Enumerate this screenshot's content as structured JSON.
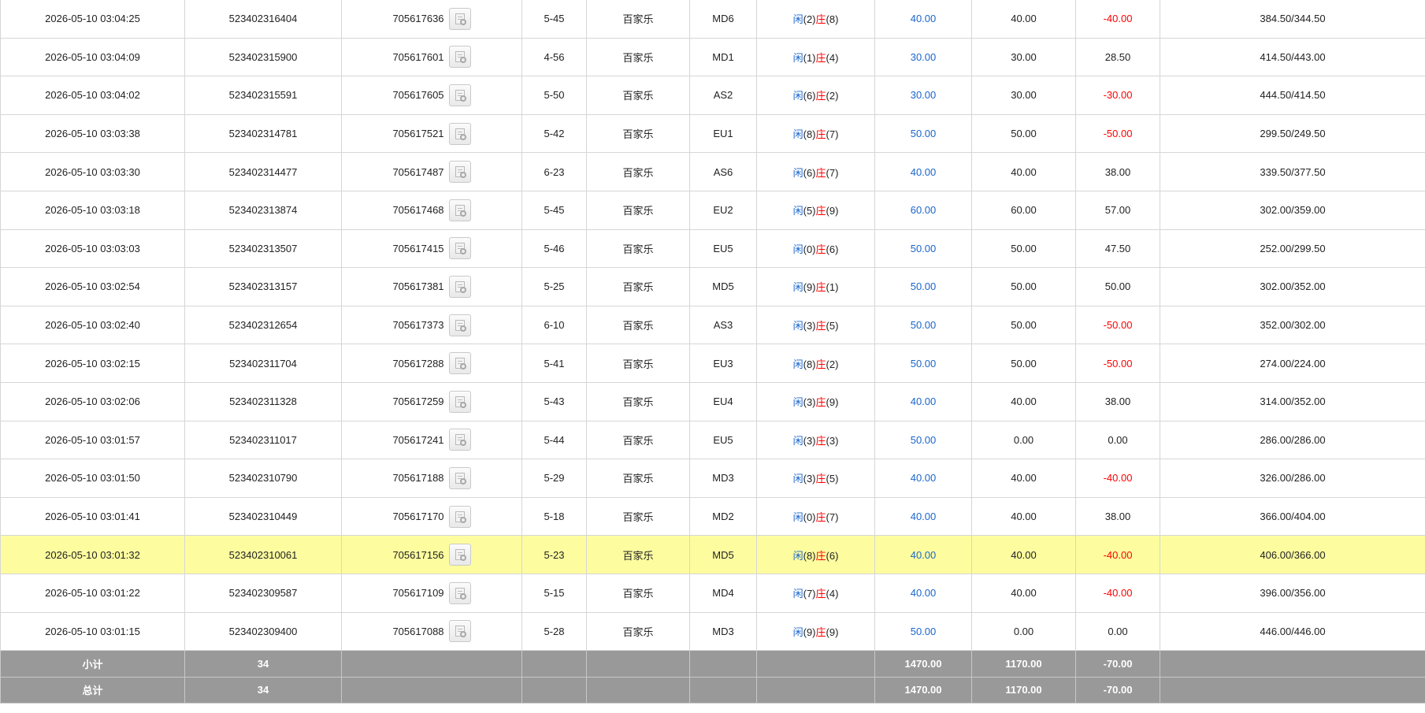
{
  "rows": [
    {
      "time": "2026-05-10 03:04:25",
      "bet_id": "523402316404",
      "round_id": "705617636",
      "shoe": "5-45",
      "game": "百家乐",
      "table": "MD6",
      "xian": "闲",
      "xian_pts": "(2)",
      "zhuang": "庄",
      "zhuang_pts": "(8)",
      "bet": "40.00",
      "valid": "40.00",
      "winloss": "-40.00",
      "balance": "384.50/344.50"
    },
    {
      "time": "2026-05-10 03:04:09",
      "bet_id": "523402315900",
      "round_id": "705617601",
      "shoe": "4-56",
      "game": "百家乐",
      "table": "MD1",
      "xian": "闲",
      "xian_pts": "(1)",
      "zhuang": "庄",
      "zhuang_pts": "(4)",
      "bet": "30.00",
      "valid": "30.00",
      "winloss": "28.50",
      "balance": "414.50/443.00"
    },
    {
      "time": "2026-05-10 03:04:02",
      "bet_id": "523402315591",
      "round_id": "705617605",
      "shoe": "5-50",
      "game": "百家乐",
      "table": "AS2",
      "xian": "闲",
      "xian_pts": "(6)",
      "zhuang": "庄",
      "zhuang_pts": "(2)",
      "bet": "30.00",
      "valid": "30.00",
      "winloss": "-30.00",
      "balance": "444.50/414.50"
    },
    {
      "time": "2026-05-10 03:03:38",
      "bet_id": "523402314781",
      "round_id": "705617521",
      "shoe": "5-42",
      "game": "百家乐",
      "table": "EU1",
      "xian": "闲",
      "xian_pts": "(8)",
      "zhuang": "庄",
      "zhuang_pts": "(7)",
      "bet": "50.00",
      "valid": "50.00",
      "winloss": "-50.00",
      "balance": "299.50/249.50"
    },
    {
      "time": "2026-05-10 03:03:30",
      "bet_id": "523402314477",
      "round_id": "705617487",
      "shoe": "6-23",
      "game": "百家乐",
      "table": "AS6",
      "xian": "闲",
      "xian_pts": "(6)",
      "zhuang": "庄",
      "zhuang_pts": "(7)",
      "bet": "40.00",
      "valid": "40.00",
      "winloss": "38.00",
      "balance": "339.50/377.50"
    },
    {
      "time": "2026-05-10 03:03:18",
      "bet_id": "523402313874",
      "round_id": "705617468",
      "shoe": "5-45",
      "game": "百家乐",
      "table": "EU2",
      "xian": "闲",
      "xian_pts": "(5)",
      "zhuang": "庄",
      "zhuang_pts": "(9)",
      "bet": "60.00",
      "valid": "60.00",
      "winloss": "57.00",
      "balance": "302.00/359.00"
    },
    {
      "time": "2026-05-10 03:03:03",
      "bet_id": "523402313507",
      "round_id": "705617415",
      "shoe": "5-46",
      "game": "百家乐",
      "table": "EU5",
      "xian": "闲",
      "xian_pts": "(0)",
      "zhuang": "庄",
      "zhuang_pts": "(6)",
      "bet": "50.00",
      "valid": "50.00",
      "winloss": "47.50",
      "balance": "252.00/299.50"
    },
    {
      "time": "2026-05-10 03:02:54",
      "bet_id": "523402313157",
      "round_id": "705617381",
      "shoe": "5-25",
      "game": "百家乐",
      "table": "MD5",
      "xian": "闲",
      "xian_pts": "(9)",
      "zhuang": "庄",
      "zhuang_pts": "(1)",
      "bet": "50.00",
      "valid": "50.00",
      "winloss": "50.00",
      "balance": "302.00/352.00"
    },
    {
      "time": "2026-05-10 03:02:40",
      "bet_id": "523402312654",
      "round_id": "705617373",
      "shoe": "6-10",
      "game": "百家乐",
      "table": "AS3",
      "xian": "闲",
      "xian_pts": "(3)",
      "zhuang": "庄",
      "zhuang_pts": "(5)",
      "bet": "50.00",
      "valid": "50.00",
      "winloss": "-50.00",
      "balance": "352.00/302.00"
    },
    {
      "time": "2026-05-10 03:02:15",
      "bet_id": "523402311704",
      "round_id": "705617288",
      "shoe": "5-41",
      "game": "百家乐",
      "table": "EU3",
      "xian": "闲",
      "xian_pts": "(8)",
      "zhuang": "庄",
      "zhuang_pts": "(2)",
      "bet": "50.00",
      "valid": "50.00",
      "winloss": "-50.00",
      "balance": "274.00/224.00"
    },
    {
      "time": "2026-05-10 03:02:06",
      "bet_id": "523402311328",
      "round_id": "705617259",
      "shoe": "5-43",
      "game": "百家乐",
      "table": "EU4",
      "xian": "闲",
      "xian_pts": "(3)",
      "zhuang": "庄",
      "zhuang_pts": "(9)",
      "bet": "40.00",
      "valid": "40.00",
      "winloss": "38.00",
      "balance": "314.00/352.00"
    },
    {
      "time": "2026-05-10 03:01:57",
      "bet_id": "523402311017",
      "round_id": "705617241",
      "shoe": "5-44",
      "game": "百家乐",
      "table": "EU5",
      "xian": "闲",
      "xian_pts": "(3)",
      "zhuang": "庄",
      "zhuang_pts": "(3)",
      "bet": "50.00",
      "valid": "0.00",
      "winloss": "0.00",
      "balance": "286.00/286.00"
    },
    {
      "time": "2026-05-10 03:01:50",
      "bet_id": "523402310790",
      "round_id": "705617188",
      "shoe": "5-29",
      "game": "百家乐",
      "table": "MD3",
      "xian": "闲",
      "xian_pts": "(3)",
      "zhuang": "庄",
      "zhuang_pts": "(5)",
      "bet": "40.00",
      "valid": "40.00",
      "winloss": "-40.00",
      "balance": "326.00/286.00"
    },
    {
      "time": "2026-05-10 03:01:41",
      "bet_id": "523402310449",
      "round_id": "705617170",
      "shoe": "5-18",
      "game": "百家乐",
      "table": "MD2",
      "xian": "闲",
      "xian_pts": "(0)",
      "zhuang": "庄",
      "zhuang_pts": "(7)",
      "bet": "40.00",
      "valid": "40.00",
      "winloss": "38.00",
      "balance": "366.00/404.00"
    },
    {
      "time": "2026-05-10 03:01:32",
      "bet_id": "523402310061",
      "round_id": "705617156",
      "shoe": "5-23",
      "game": "百家乐",
      "table": "MD5",
      "xian": "闲",
      "xian_pts": "(8)",
      "zhuang": "庄",
      "zhuang_pts": "(6)",
      "bet": "40.00",
      "valid": "40.00",
      "winloss": "-40.00",
      "balance": "406.00/366.00",
      "highlighted": true
    },
    {
      "time": "2026-05-10 03:01:22",
      "bet_id": "523402309587",
      "round_id": "705617109",
      "shoe": "5-15",
      "game": "百家乐",
      "table": "MD4",
      "xian": "闲",
      "xian_pts": "(7)",
      "zhuang": "庄",
      "zhuang_pts": "(4)",
      "bet": "40.00",
      "valid": "40.00",
      "winloss": "-40.00",
      "balance": "396.00/356.00"
    },
    {
      "time": "2026-05-10 03:01:15",
      "bet_id": "523402309400",
      "round_id": "705617088",
      "shoe": "5-28",
      "game": "百家乐",
      "table": "MD3",
      "xian": "闲",
      "xian_pts": "(9)",
      "zhuang": "庄",
      "zhuang_pts": "(9)",
      "bet": "50.00",
      "valid": "0.00",
      "winloss": "0.00",
      "balance": "446.00/446.00"
    }
  ],
  "subtotal": {
    "label": "小计",
    "count": "34",
    "bet": "1470.00",
    "valid": "1170.00",
    "winloss": "-70.00"
  },
  "total": {
    "label": "总计",
    "count": "34",
    "bet": "1470.00",
    "valid": "1170.00",
    "winloss": "-70.00"
  },
  "colors": {
    "highlight_row": "#fdfda0",
    "summary_bg": "#999999",
    "positive_blue": "#1a66cc",
    "negative_red": "#ff0000"
  },
  "icons": {
    "round_detail": "document-gear-icon"
  }
}
